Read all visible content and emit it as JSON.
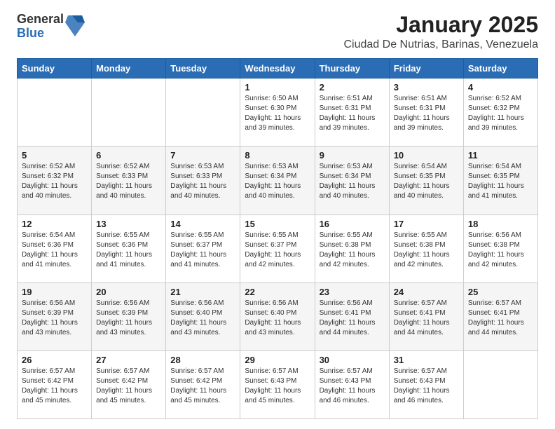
{
  "logo": {
    "general": "General",
    "blue": "Blue"
  },
  "title": "January 2025",
  "subtitle": "Ciudad De Nutrias, Barinas, Venezuela",
  "days_of_week": [
    "Sunday",
    "Monday",
    "Tuesday",
    "Wednesday",
    "Thursday",
    "Friday",
    "Saturday"
  ],
  "weeks": [
    [
      {
        "day": "",
        "info": ""
      },
      {
        "day": "",
        "info": ""
      },
      {
        "day": "",
        "info": ""
      },
      {
        "day": "1",
        "info": "Sunrise: 6:50 AM\nSunset: 6:30 PM\nDaylight: 11 hours and 39 minutes."
      },
      {
        "day": "2",
        "info": "Sunrise: 6:51 AM\nSunset: 6:31 PM\nDaylight: 11 hours and 39 minutes."
      },
      {
        "day": "3",
        "info": "Sunrise: 6:51 AM\nSunset: 6:31 PM\nDaylight: 11 hours and 39 minutes."
      },
      {
        "day": "4",
        "info": "Sunrise: 6:52 AM\nSunset: 6:32 PM\nDaylight: 11 hours and 39 minutes."
      }
    ],
    [
      {
        "day": "5",
        "info": "Sunrise: 6:52 AM\nSunset: 6:32 PM\nDaylight: 11 hours and 40 minutes."
      },
      {
        "day": "6",
        "info": "Sunrise: 6:52 AM\nSunset: 6:33 PM\nDaylight: 11 hours and 40 minutes."
      },
      {
        "day": "7",
        "info": "Sunrise: 6:53 AM\nSunset: 6:33 PM\nDaylight: 11 hours and 40 minutes."
      },
      {
        "day": "8",
        "info": "Sunrise: 6:53 AM\nSunset: 6:34 PM\nDaylight: 11 hours and 40 minutes."
      },
      {
        "day": "9",
        "info": "Sunrise: 6:53 AM\nSunset: 6:34 PM\nDaylight: 11 hours and 40 minutes."
      },
      {
        "day": "10",
        "info": "Sunrise: 6:54 AM\nSunset: 6:35 PM\nDaylight: 11 hours and 40 minutes."
      },
      {
        "day": "11",
        "info": "Sunrise: 6:54 AM\nSunset: 6:35 PM\nDaylight: 11 hours and 41 minutes."
      }
    ],
    [
      {
        "day": "12",
        "info": "Sunrise: 6:54 AM\nSunset: 6:36 PM\nDaylight: 11 hours and 41 minutes."
      },
      {
        "day": "13",
        "info": "Sunrise: 6:55 AM\nSunset: 6:36 PM\nDaylight: 11 hours and 41 minutes."
      },
      {
        "day": "14",
        "info": "Sunrise: 6:55 AM\nSunset: 6:37 PM\nDaylight: 11 hours and 41 minutes."
      },
      {
        "day": "15",
        "info": "Sunrise: 6:55 AM\nSunset: 6:37 PM\nDaylight: 11 hours and 42 minutes."
      },
      {
        "day": "16",
        "info": "Sunrise: 6:55 AM\nSunset: 6:38 PM\nDaylight: 11 hours and 42 minutes."
      },
      {
        "day": "17",
        "info": "Sunrise: 6:55 AM\nSunset: 6:38 PM\nDaylight: 11 hours and 42 minutes."
      },
      {
        "day": "18",
        "info": "Sunrise: 6:56 AM\nSunset: 6:38 PM\nDaylight: 11 hours and 42 minutes."
      }
    ],
    [
      {
        "day": "19",
        "info": "Sunrise: 6:56 AM\nSunset: 6:39 PM\nDaylight: 11 hours and 43 minutes."
      },
      {
        "day": "20",
        "info": "Sunrise: 6:56 AM\nSunset: 6:39 PM\nDaylight: 11 hours and 43 minutes."
      },
      {
        "day": "21",
        "info": "Sunrise: 6:56 AM\nSunset: 6:40 PM\nDaylight: 11 hours and 43 minutes."
      },
      {
        "day": "22",
        "info": "Sunrise: 6:56 AM\nSunset: 6:40 PM\nDaylight: 11 hours and 43 minutes."
      },
      {
        "day": "23",
        "info": "Sunrise: 6:56 AM\nSunset: 6:41 PM\nDaylight: 11 hours and 44 minutes."
      },
      {
        "day": "24",
        "info": "Sunrise: 6:57 AM\nSunset: 6:41 PM\nDaylight: 11 hours and 44 minutes."
      },
      {
        "day": "25",
        "info": "Sunrise: 6:57 AM\nSunset: 6:41 PM\nDaylight: 11 hours and 44 minutes."
      }
    ],
    [
      {
        "day": "26",
        "info": "Sunrise: 6:57 AM\nSunset: 6:42 PM\nDaylight: 11 hours and 45 minutes."
      },
      {
        "day": "27",
        "info": "Sunrise: 6:57 AM\nSunset: 6:42 PM\nDaylight: 11 hours and 45 minutes."
      },
      {
        "day": "28",
        "info": "Sunrise: 6:57 AM\nSunset: 6:42 PM\nDaylight: 11 hours and 45 minutes."
      },
      {
        "day": "29",
        "info": "Sunrise: 6:57 AM\nSunset: 6:43 PM\nDaylight: 11 hours and 45 minutes."
      },
      {
        "day": "30",
        "info": "Sunrise: 6:57 AM\nSunset: 6:43 PM\nDaylight: 11 hours and 46 minutes."
      },
      {
        "day": "31",
        "info": "Sunrise: 6:57 AM\nSunset: 6:43 PM\nDaylight: 11 hours and 46 minutes."
      },
      {
        "day": "",
        "info": ""
      }
    ]
  ]
}
